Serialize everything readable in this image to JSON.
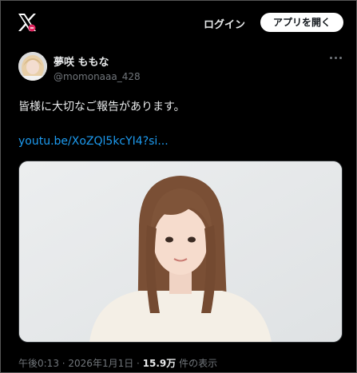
{
  "header": {
    "logo_icon": "x-logo-icon",
    "login_label": "ログイン",
    "open_app_label": "アプリを開く"
  },
  "tweet": {
    "author_name": "夢咲 ももな",
    "author_handle": "@momonaaa_428",
    "text": "皆様に大切なご報告があります。",
    "link": "youtu.be/XoZQl5kcYI4?si...",
    "media_icon": "video-thumbnail-icon",
    "time": "午後0:13",
    "sep1": " · ",
    "date": "2026年1月1日",
    "sep2": " · ",
    "views_count": "15.9万",
    "views_label": " 件の表示"
  },
  "colors": {
    "background": "#000000",
    "text": "#e7e9ea",
    "muted": "#71767b",
    "link": "#1d9bf0",
    "button_bg": "#ffffff"
  }
}
